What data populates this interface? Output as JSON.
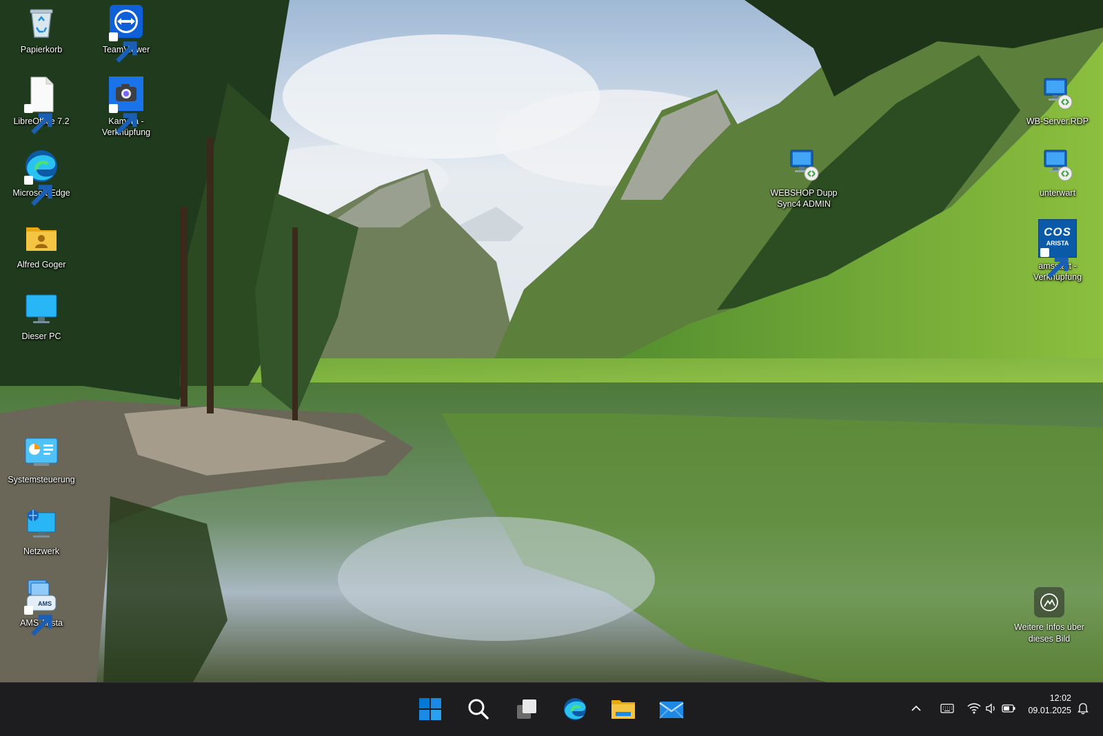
{
  "desktop": {
    "icons": [
      {
        "label": "Papierkorb"
      },
      {
        "label": "TeamViewer"
      },
      {
        "label": "LibreOffice 7.2"
      },
      {
        "label": "Kamera - Verknüpfung"
      },
      {
        "label": "Microsoft Edge"
      },
      {
        "label": "Alfred Goger"
      },
      {
        "label": "Dieser PC"
      },
      {
        "label": "Systemsteuerung"
      },
      {
        "label": "Netzwerk"
      },
      {
        "label": "AMS Arista"
      },
      {
        "label": "WEBSHOP Dupp Sync4 ADMIN"
      },
      {
        "label": "WB-Server.RDP"
      },
      {
        "label": "unterwart"
      },
      {
        "label": "amsstart - Verknüpfung"
      }
    ],
    "arista_badge": {
      "line1": "COS",
      "line2": "ARISTA"
    },
    "ams_badge": "AMS",
    "info_spot": {
      "label": "Weitere Infos über dieses Bild"
    }
  },
  "taskbar": {
    "apps": [
      "start-icon",
      "search-icon",
      "task-view-icon",
      "edge-icon",
      "file-explorer-icon",
      "mail-icon"
    ],
    "tray": [
      "chevron-up-icon",
      "keyboard-icon",
      "wifi-icon",
      "volume-icon",
      "battery-icon",
      "notification-bell-icon"
    ],
    "clock": {
      "time": "12:02",
      "date": "09.01.2025"
    }
  },
  "colors": {
    "taskbar_bg": "#1d1c1f",
    "win_blue": "#0078d4",
    "folder_yellow": "#f4c542",
    "teamviewer_blue": "#0e5fd8"
  }
}
